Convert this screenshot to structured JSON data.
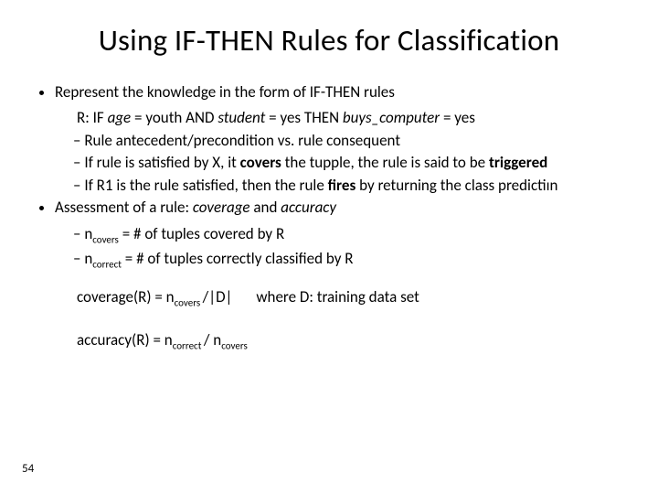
{
  "title": "Using IF-THEN Rules for Classification",
  "bullets": {
    "b1": "Represent the knowledge in the form of IF-THEN rules",
    "rline_prefix": "R:  IF ",
    "rline_age": "age",
    "rline_mid1": " = youth AND ",
    "rline_student": "student",
    "rline_mid2": " = yes  THEN ",
    "rline_buys": "buys_computer",
    "rline_end": " = yes",
    "s1": "Rule antecedent/precondition vs. rule consequent",
    "s2_a": "If rule is satisfied by X, it ",
    "s2_b": "covers",
    "s2_c": " the tupple, the rule is said to be ",
    "s2_d": "triggered",
    "s3_a": "If R1 is the rule satisfied, then the rule ",
    "s3_b": "fires",
    "s3_c": " by returning the class predictiın",
    "b2_a": "Assessment of a rule: ",
    "b2_b": "coverage",
    "b2_c": " and ",
    "b2_d": "accuracy",
    "s4_a": "n",
    "s4_sub": "covers",
    "s4_b": " = # of tuples covered by R",
    "s5_a": "n",
    "s5_sub": "correct",
    "s5_b": " = # of tuples correctly classified by R"
  },
  "formulas": {
    "f1_a": "coverage(R) = n",
    "f1_sub": "covers ",
    "f1_b": "/|D|",
    "f1_where": "where  D: training data set",
    "f2_a": "accuracy(R) = n",
    "f2_sub1": "correct ",
    "f2_b": "/ n",
    "f2_sub2": "covers"
  },
  "page": "54"
}
